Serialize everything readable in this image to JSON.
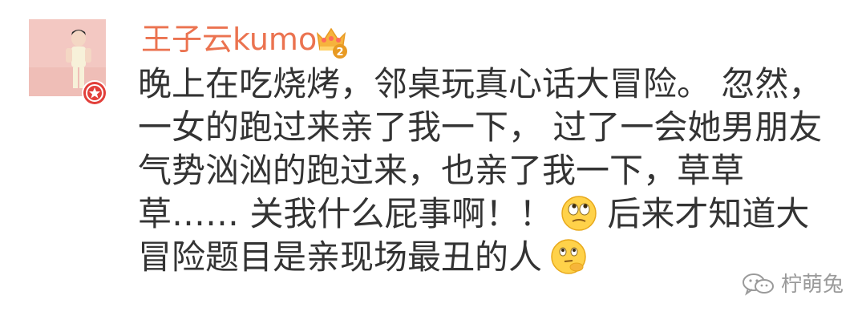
{
  "user": {
    "name": "王子云kumo",
    "name_color": "#eb7350",
    "avatar_icon": "avatar-photo",
    "verified_icon": "verified-star-badge",
    "level_icon": "crown-level-badge",
    "level_number": "2"
  },
  "post": {
    "lines": [
      "晚上在吃烧烤，邻桌玩真心话大冒险。 忽然，",
      "一女的跑过来亲了我一下， 过了一会她男朋友",
      "气势汹汹的跑过来，也亲了我一下，草草",
      "草…… 关我什么屁事啊！！",
      "后来才知道大",
      "冒险题目是亲现场最丑的人"
    ],
    "emoji_1": "rolling-eyes-emoji",
    "emoji_2": "thinking-emoji"
  },
  "watermark": {
    "text": "柠萌兔",
    "icon": "wechat-icon"
  }
}
